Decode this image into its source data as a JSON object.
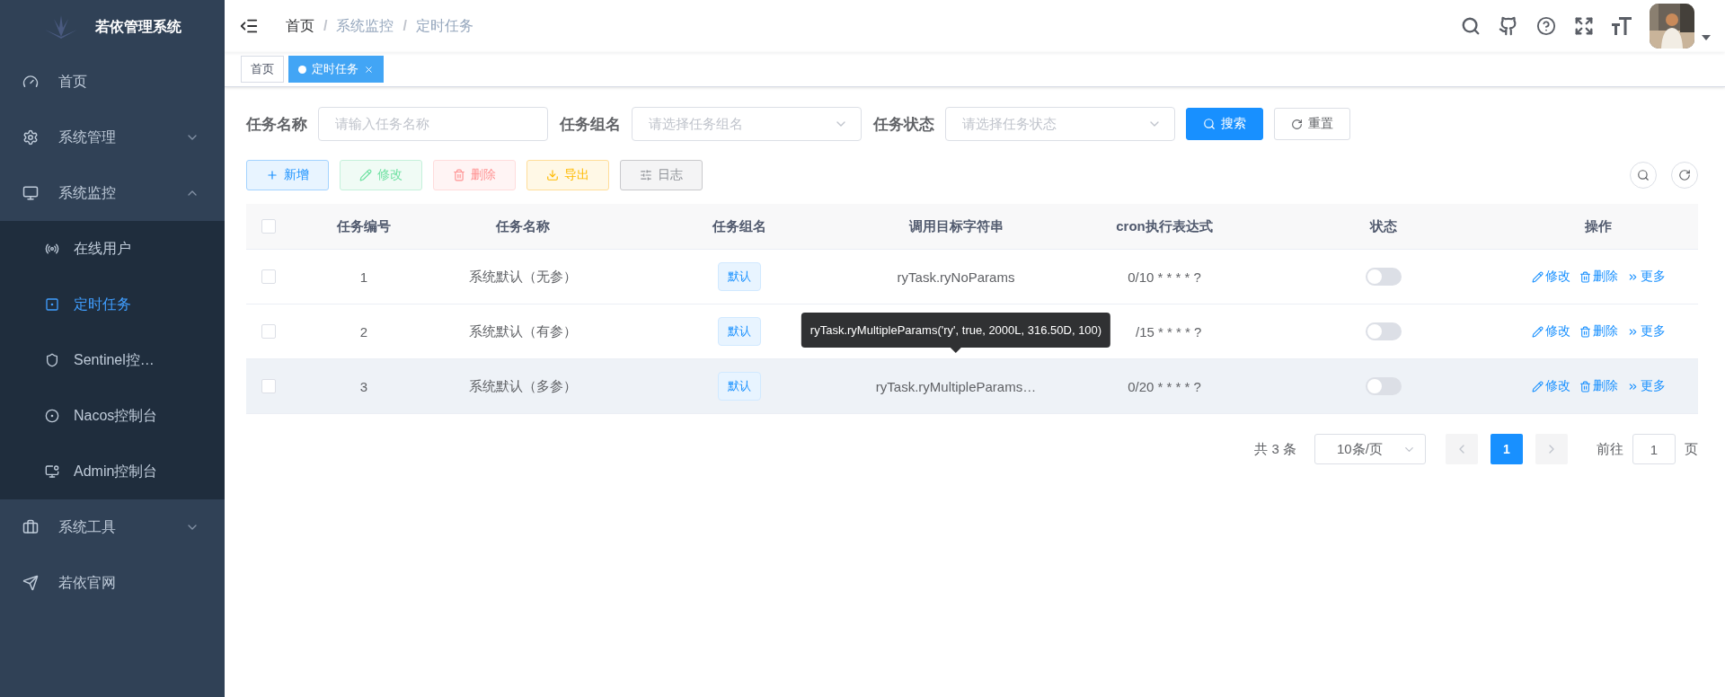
{
  "sidebar": {
    "title": "若依管理系统",
    "items": [
      {
        "label": "首页",
        "selected": false
      },
      {
        "label": "系统管理",
        "selected": false,
        "expanded": false
      },
      {
        "label": "系统监控",
        "selected": false,
        "expanded": true,
        "children": [
          {
            "label": "在线用户",
            "selected": false
          },
          {
            "label": "定时任务",
            "selected": true
          },
          {
            "label": "Sentinel控…",
            "selected": false
          },
          {
            "label": "Nacos控制台",
            "selected": false
          },
          {
            "label": "Admin控制台",
            "selected": false
          }
        ]
      },
      {
        "label": "系统工具",
        "selected": false,
        "expanded": false
      },
      {
        "label": "若依官网",
        "selected": false
      }
    ]
  },
  "breadcrumb": {
    "items": [
      "首页",
      "系统监控",
      "定时任务"
    ],
    "separator": "/"
  },
  "tags": [
    {
      "label": "首页",
      "selected": false
    },
    {
      "label": "定时任务",
      "selected": true
    }
  ],
  "filters": [
    {
      "label": "任务名称",
      "kind": "input",
      "placeholder": "请输入任务名称"
    },
    {
      "label": "任务组名",
      "kind": "select",
      "placeholder": "请选择任务组名"
    },
    {
      "label": "任务状态",
      "kind": "select",
      "placeholder": "请选择任务状态"
    }
  ],
  "search_buttons": [
    {
      "label": "搜索",
      "kind": "primary"
    },
    {
      "label": "重置",
      "kind": "plain"
    }
  ],
  "actions": [
    {
      "label": "新增",
      "kind": "primary",
      "disabled": false
    },
    {
      "label": "修改",
      "kind": "success",
      "disabled": true
    },
    {
      "label": "删除",
      "kind": "danger",
      "disabled": true
    },
    {
      "label": "导出",
      "kind": "warning",
      "disabled": false
    },
    {
      "label": "日志",
      "kind": "info",
      "disabled": false
    }
  ],
  "table": {
    "select_all": {
      "checked": false
    },
    "columns": [
      "任务编号",
      "任务名称",
      "任务组名",
      "调用目标字符串",
      "cron执行表达式",
      "状态",
      "操作"
    ],
    "rows": [
      {
        "checked": false,
        "highlighted": false,
        "id": "1",
        "name": "系统默认（无参）",
        "group": "默认",
        "target": "ryTask.ryNoParams",
        "cron": "0/10 * * * * ?",
        "on": false,
        "ops": [
          "修改",
          "删除",
          "更多"
        ]
      },
      {
        "checked": false,
        "highlighted": false,
        "id": "2",
        "name": "系统默认（有参）",
        "group": "默认",
        "tooltip": "ryTask.ryMultipleParams('ry', true, 2000L, 316.50D, 100)",
        "cron": "/15 * * * * ?",
        "on": false,
        "ops": [
          "修改",
          "删除",
          "更多"
        ]
      },
      {
        "checked": false,
        "highlighted": true,
        "id": "3",
        "name": "系统默认（多参）",
        "group": "默认",
        "target": "ryTask.ryMultipleParams…",
        "cron": "0/20 * * * * ?",
        "on": false,
        "ops": [
          "修改",
          "删除",
          "更多"
        ]
      }
    ]
  },
  "pagination": {
    "total": "共 3 条",
    "page_size": "10条/页",
    "pages": [
      {
        "label": "1",
        "selected": true
      }
    ],
    "goto_label": "前往",
    "goto_value": "1",
    "goto_suffix": "页"
  }
}
